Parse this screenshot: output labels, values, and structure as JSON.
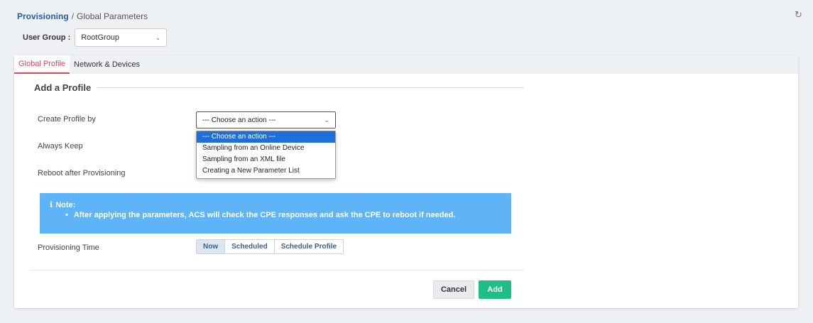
{
  "breadcrumb": {
    "main": "Provisioning",
    "separator": "/",
    "current": "Global Parameters"
  },
  "user_group": {
    "label": "User Group :",
    "value": "RootGroup"
  },
  "tabs": [
    {
      "label": "Global Profile",
      "active": true
    },
    {
      "label": "Network & Devices",
      "active": false
    }
  ],
  "section": {
    "title": "Add a Profile"
  },
  "form": {
    "create_profile_label": "Create Profile by",
    "create_profile_value": "--- Choose an action ---",
    "always_keep_label": "Always Keep",
    "reboot_label": "Reboot after Provisioning",
    "provisioning_time_label": "Provisioning Time"
  },
  "dropdown_options": [
    "--- Choose an action ---",
    "Sampling from an Online Device",
    "Sampling from an XML file",
    "Creating a New Parameter List"
  ],
  "note": {
    "title": "Note:",
    "text": "After applying the parameters, ACS will check the CPE responses and ask the CPE to reboot if needed."
  },
  "provisioning_time_options": [
    {
      "label": "Now",
      "active": true
    },
    {
      "label": "Scheduled",
      "active": false
    },
    {
      "label": "Schedule Profile",
      "active": false
    }
  ],
  "buttons": {
    "cancel": "Cancel",
    "add": "Add"
  },
  "colors": {
    "accent_tab": "#e0455a",
    "add_button": "#1fbe85",
    "note_bg": "#5fb3f7",
    "dropdown_selected": "#1e6fd9"
  }
}
